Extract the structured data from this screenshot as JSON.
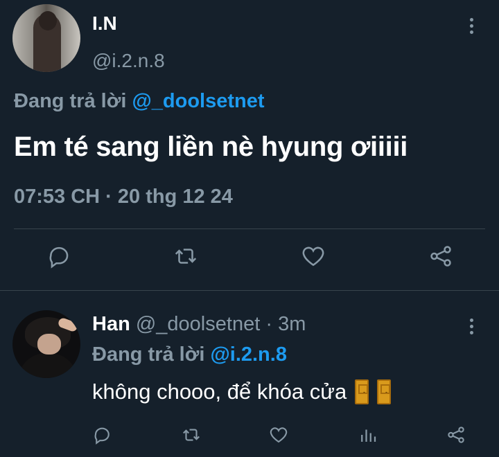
{
  "main_tweet": {
    "author_name": "I.N",
    "author_handle": "@i.2.n.8",
    "replying_prefix": "Đang trả lời",
    "replying_to": "@_doolsetnet",
    "text": "Em té sang liền nè hyung ơiiiii",
    "timestamp": "07:53 CH · 20 thg 12 24",
    "actions": [
      "reply-icon",
      "retweet-icon",
      "like-icon",
      "share-icon"
    ]
  },
  "reply_tweet": {
    "author_name": "Han",
    "author_handle": "@_doolsetnet",
    "time_sep": "·",
    "time": "3m",
    "replying_prefix": "Đang trả lời",
    "replying_to": "@i.2.n.8",
    "text": "không chooo, để khóa cửa",
    "actions": [
      "reply-icon",
      "retweet-icon",
      "like-icon",
      "analytics-icon",
      "share-icon"
    ]
  },
  "colors": {
    "background": "#15202b",
    "muted": "#8899a6",
    "link": "#1d9bf0",
    "divider": "#38444d"
  }
}
